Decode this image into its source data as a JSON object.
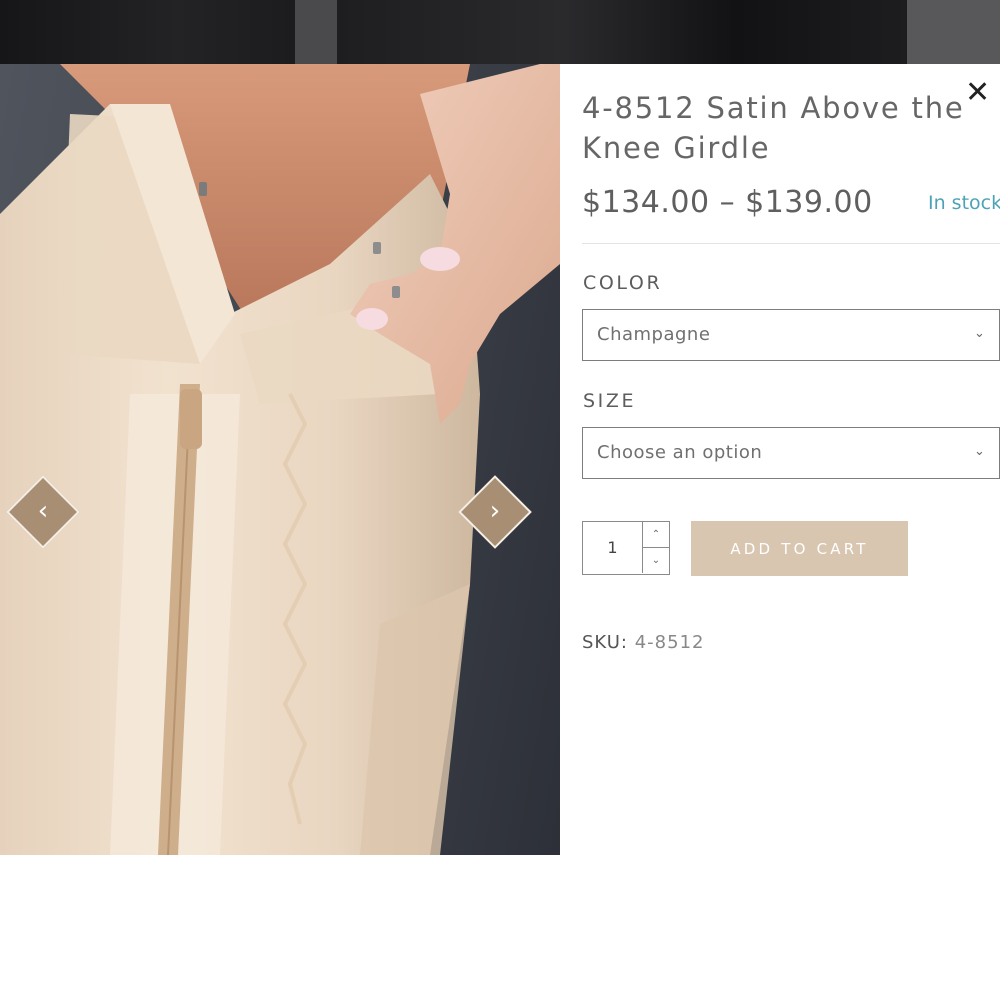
{
  "product": {
    "title": "4-8512 Satin Above the Knee Girdle",
    "price_range": "$134.00 – $139.00",
    "stock_status": "In stock",
    "sku_label": "SKU:",
    "sku_value": "4-8512"
  },
  "options": {
    "color_label": "COLOR",
    "color_value": "Champagne",
    "size_label": "SIZE",
    "size_value": "Choose an option"
  },
  "cart": {
    "quantity": "1",
    "add_to_cart_label": "ADD TO CART"
  },
  "gallery": {
    "slide_count": 5,
    "active_slide": 4,
    "prev_icon": "chevron-left-icon",
    "next_icon": "chevron-right-icon"
  },
  "modal": {
    "close_icon": "close-icon"
  },
  "colors": {
    "accent": "#a88f73",
    "button": "#d9c6b1",
    "stock": "#4da3b5"
  }
}
